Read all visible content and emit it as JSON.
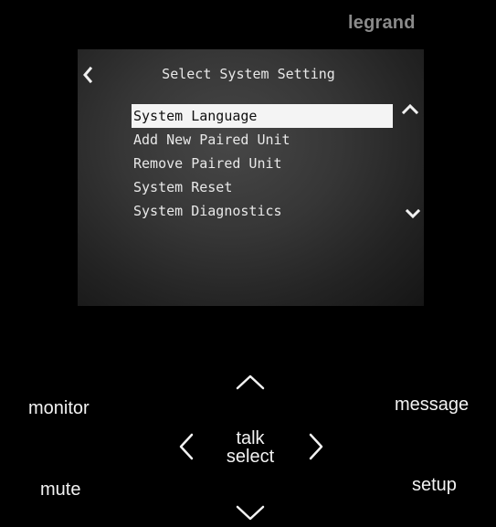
{
  "brand": {
    "name": "legrand"
  },
  "screen": {
    "title": "Select System Setting",
    "items": [
      {
        "label": "System Language",
        "selected": true
      },
      {
        "label": "Add New Paired Unit",
        "selected": false
      },
      {
        "label": "Remove Paired Unit",
        "selected": false
      },
      {
        "label": "System Reset",
        "selected": false
      },
      {
        "label": "System Diagnostics",
        "selected": false
      }
    ],
    "icons": {
      "back": "chevron-left-icon",
      "scroll_up": "chevron-up-icon",
      "scroll_down": "chevron-down-icon"
    }
  },
  "controls": {
    "monitor": "monitor",
    "message": "message",
    "mute": "mute",
    "setup": "setup",
    "center_line1": "talk",
    "center_line2": "select"
  },
  "colors": {
    "background": "#000000",
    "brand": "#8a8a8a",
    "highlight": "#f4f4f4",
    "text": "#e8e8e8"
  }
}
